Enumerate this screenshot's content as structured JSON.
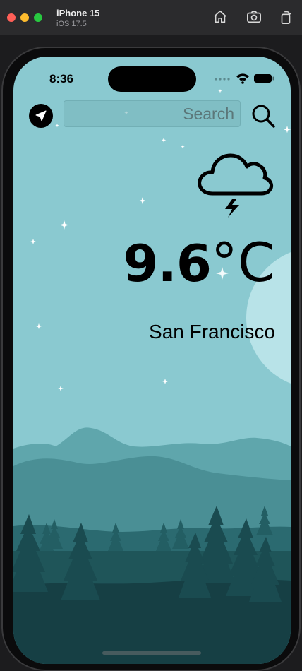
{
  "simulator": {
    "device_name": "iPhone 15",
    "os_version": "iOS 17.5",
    "buttons": [
      "home-icon",
      "screenshot-icon",
      "rotate-icon"
    ]
  },
  "status_bar": {
    "time": "8:36",
    "icons": [
      "signal-icon",
      "wifi-icon",
      "battery-icon"
    ]
  },
  "toolbar": {
    "location_icon": "location-arrow-icon",
    "search_placeholder": "Search",
    "search_value": "",
    "search_icon": "search-icon"
  },
  "weather": {
    "condition_icon": "cloud-lightning-icon",
    "temperature": "9.6",
    "unit": "°C",
    "city": "San Francisco"
  },
  "colors": {
    "sky": "#8ac9d0",
    "moon": "#b8e3e8",
    "mountain_far": "#5fa6ac",
    "mountain_mid": "#3f8389",
    "forest": "#235e63",
    "ground": "#163f44"
  }
}
